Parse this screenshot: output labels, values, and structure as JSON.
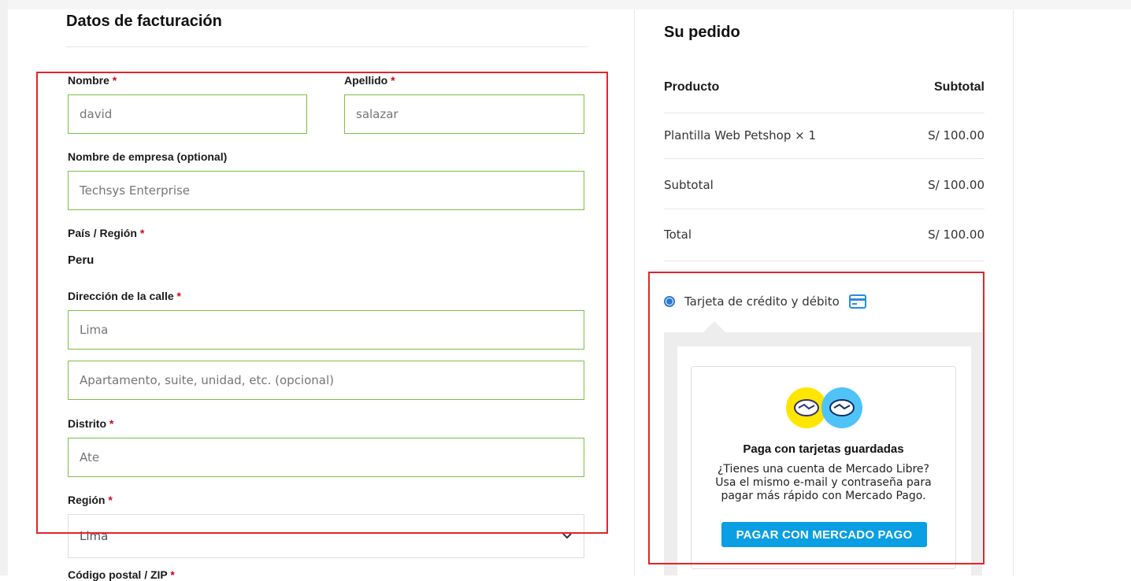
{
  "billing": {
    "title": "Datos de facturación",
    "required_mark": "*",
    "first_name": {
      "label": "Nombre",
      "value": "david"
    },
    "last_name": {
      "label": "Apellido",
      "value": "salazar"
    },
    "company": {
      "label": "Nombre de empresa (optional)",
      "value": "Techsys Enterprise"
    },
    "country": {
      "label": "País / Región",
      "value": "Peru"
    },
    "street": {
      "label": "Dirección de la calle",
      "value": "Lima",
      "line2_placeholder": "Apartamento, suite, unidad, etc. (opcional)"
    },
    "district": {
      "label": "Distrito",
      "value": "Ate"
    },
    "region": {
      "label": "Región",
      "value": "Lima"
    },
    "postcode": {
      "label": "Código postal / ZIP"
    }
  },
  "order": {
    "title": "Su pedido",
    "col_product": "Producto",
    "col_subtotal": "Subtotal",
    "items": [
      {
        "name": "Plantilla Web Petshop × 1",
        "amount": "S/ 100.00"
      }
    ],
    "subtotal_label": "Subtotal",
    "subtotal_value": "S/ 100.00",
    "total_label": "Total",
    "total_value": "S/ 100.00"
  },
  "payment": {
    "method_label": "Tarjeta de crédito y débito",
    "method_icon": "credit-card-icon",
    "heading": "Paga con tarjetas guardadas",
    "text_lines": [
      "¿Tienes una cuenta de Mercado Libre?",
      "Usa el mismo e-mail y contraseña para",
      "pagar más rápido con Mercado Pago."
    ],
    "button_label": "PAGAR CON MERCADO PAGO"
  },
  "colors": {
    "field_border": "#7bc043",
    "highlight": "#e0262c",
    "required": "#d6001c",
    "accent_blue": "#2a78d0",
    "mp_button": "#0a9ee3",
    "mp_yellow": "#ffe600",
    "mp_blue": "#4fc3f7"
  }
}
